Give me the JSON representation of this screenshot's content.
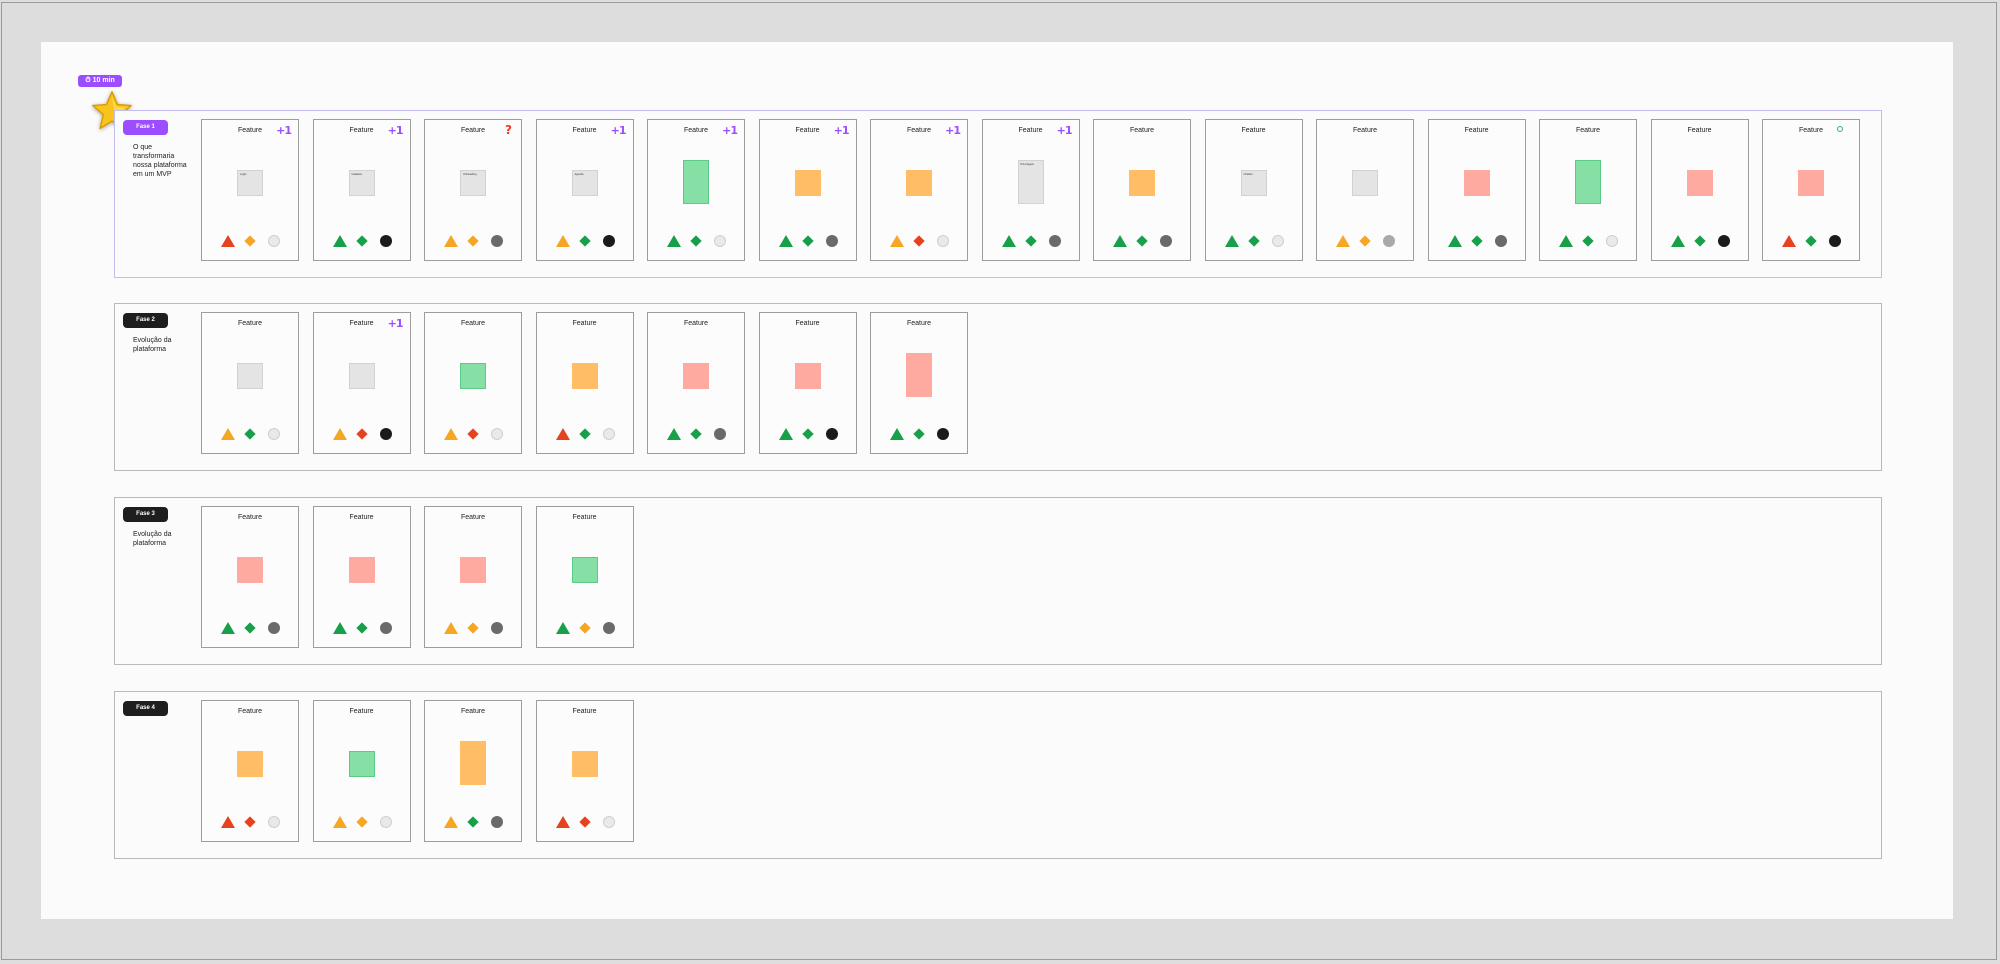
{
  "colors": {
    "purple": "#9b4dff",
    "dark_badge": "#1e1e1e",
    "green": "#17a049",
    "orange": "#f5a623",
    "red": "#e5431f",
    "black": "#1b1b1b",
    "dark_grey": "#6a6a6a",
    "mid_grey": "#a9a9a9",
    "light": "#e9e9ec"
  },
  "timer": {
    "label": "⏱ 10 min"
  },
  "phases": [
    {
      "badge": "Fase 1",
      "badge_color": "#9b4dff",
      "description": "O que transformaria nossa plataforma em um MVP",
      "cards": [
        {
          "title": "Feature",
          "badge": "plus",
          "sticky": {
            "color": "grey",
            "text": "Login"
          },
          "shapes": [
            "red",
            "orange",
            "light"
          ]
        },
        {
          "title": "Feature",
          "badge": "plus",
          "sticky": {
            "color": "grey",
            "text": "Cadastro"
          },
          "shapes": [
            "green",
            "green",
            "black"
          ]
        },
        {
          "title": "Feature",
          "badge": "question",
          "sticky": {
            "color": "grey",
            "text": "Onboarding"
          },
          "shapes": [
            "orange",
            "orange",
            "dark_grey"
          ]
        },
        {
          "title": "Feature",
          "badge": "plus",
          "sticky": {
            "color": "grey",
            "text": "Agenda"
          },
          "shapes": [
            "orange",
            "green",
            "black"
          ]
        },
        {
          "title": "Feature",
          "badge": "plus",
          "sticky": {
            "color": "green",
            "text": "",
            "tall": true
          },
          "shapes": [
            "green",
            "green",
            "light"
          ]
        },
        {
          "title": "Feature",
          "badge": "plus",
          "sticky": {
            "color": "orange",
            "text": ""
          },
          "shapes": [
            "green",
            "green",
            "dark_grey"
          ]
        },
        {
          "title": "Feature",
          "badge": "plus",
          "sticky": {
            "color": "orange",
            "text": ""
          },
          "shapes": [
            "orange",
            "red",
            "light"
          ]
        },
        {
          "title": "Feature",
          "badge": "plus",
          "sticky": {
            "color": "grey",
            "text": "Pré-triagem",
            "tall": true
          },
          "shapes": [
            "green",
            "green",
            "dark_grey"
          ]
        },
        {
          "title": "Feature",
          "badge": "none",
          "sticky": {
            "color": "orange",
            "text": ""
          },
          "shapes": [
            "green",
            "green",
            "dark_grey"
          ]
        },
        {
          "title": "Feature",
          "badge": "none",
          "sticky": {
            "color": "grey",
            "text": "Chatbot"
          },
          "shapes": [
            "green",
            "green",
            "light"
          ]
        },
        {
          "title": "Feature",
          "badge": "none",
          "sticky": {
            "color": "grey",
            "text": ""
          },
          "shapes": [
            "orange",
            "orange",
            "mid_grey"
          ]
        },
        {
          "title": "Feature",
          "badge": "none",
          "sticky": {
            "color": "red",
            "text": ""
          },
          "shapes": [
            "green",
            "green",
            "dark_grey"
          ]
        },
        {
          "title": "Feature",
          "badge": "none",
          "sticky": {
            "color": "green",
            "text": "",
            "tall": true
          },
          "shapes": [
            "green",
            "green",
            "light"
          ]
        },
        {
          "title": "Feature",
          "badge": "none",
          "sticky": {
            "color": "red",
            "text": ""
          },
          "shapes": [
            "green",
            "green",
            "black"
          ]
        },
        {
          "title": "Feature",
          "badge": "info",
          "sticky": {
            "color": "red",
            "text": ""
          },
          "shapes": [
            "red",
            "green",
            "black"
          ]
        }
      ]
    },
    {
      "badge": "Fase 2",
      "badge_color": "#1e1e1e",
      "description": "Evolução da plataforma",
      "cards": [
        {
          "title": "Feature",
          "badge": "none",
          "sticky": {
            "color": "grey",
            "text": ""
          },
          "shapes": [
            "orange",
            "green",
            "light"
          ]
        },
        {
          "title": "Feature",
          "badge": "plus",
          "sticky": {
            "color": "grey",
            "text": ""
          },
          "shapes": [
            "orange",
            "red",
            "black"
          ]
        },
        {
          "title": "Feature",
          "badge": "none",
          "sticky": {
            "color": "green",
            "text": ""
          },
          "shapes": [
            "orange",
            "red",
            "light"
          ]
        },
        {
          "title": "Feature",
          "badge": "none",
          "sticky": {
            "color": "orange",
            "text": ""
          },
          "shapes": [
            "red",
            "green",
            "light"
          ]
        },
        {
          "title": "Feature",
          "badge": "none",
          "sticky": {
            "color": "red",
            "text": ""
          },
          "shapes": [
            "green",
            "green",
            "dark_grey"
          ]
        },
        {
          "title": "Feature",
          "badge": "none",
          "sticky": {
            "color": "red",
            "text": ""
          },
          "shapes": [
            "green",
            "green",
            "black"
          ]
        },
        {
          "title": "Feature",
          "badge": "none",
          "sticky": {
            "color": "red",
            "text": "",
            "tall": true
          },
          "shapes": [
            "green",
            "green",
            "black"
          ]
        }
      ]
    },
    {
      "badge": "Fase 3",
      "badge_color": "#1e1e1e",
      "description": "Evolução da plataforma",
      "cards": [
        {
          "title": "Feature",
          "badge": "none",
          "sticky": {
            "color": "red",
            "text": ""
          },
          "shapes": [
            "green",
            "green",
            "dark_grey"
          ]
        },
        {
          "title": "Feature",
          "badge": "none",
          "sticky": {
            "color": "red",
            "text": ""
          },
          "shapes": [
            "green",
            "green",
            "dark_grey"
          ]
        },
        {
          "title": "Feature",
          "badge": "none",
          "sticky": {
            "color": "red",
            "text": ""
          },
          "shapes": [
            "orange",
            "orange",
            "dark_grey"
          ]
        },
        {
          "title": "Feature",
          "badge": "none",
          "sticky": {
            "color": "green",
            "text": ""
          },
          "shapes": [
            "green",
            "orange",
            "dark_grey"
          ]
        }
      ]
    },
    {
      "badge": "Fase 4",
      "badge_color": "#1e1e1e",
      "description": "",
      "cards": [
        {
          "title": "Feature",
          "badge": "none",
          "sticky": {
            "color": "orange",
            "text": ""
          },
          "shapes": [
            "red",
            "red",
            "light"
          ]
        },
        {
          "title": "Feature",
          "badge": "none",
          "sticky": {
            "color": "green",
            "text": ""
          },
          "shapes": [
            "orange",
            "orange",
            "light"
          ]
        },
        {
          "title": "Feature",
          "badge": "none",
          "sticky": {
            "color": "orange",
            "text": "",
            "tall": true
          },
          "shapes": [
            "orange",
            "green",
            "dark_grey"
          ]
        },
        {
          "title": "Feature",
          "badge": "none",
          "sticky": {
            "color": "orange",
            "text": ""
          },
          "shapes": [
            "red",
            "red",
            "light"
          ]
        }
      ]
    }
  ]
}
